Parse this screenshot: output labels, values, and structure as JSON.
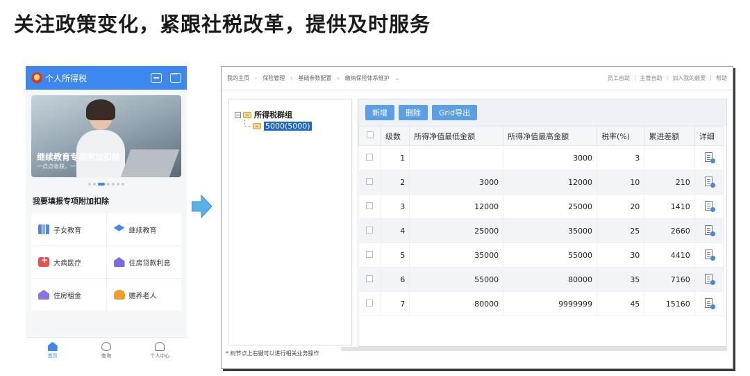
{
  "headline": "关注政策变化，紧跟社税改革，提供及时服务",
  "phone": {
    "app_title": "个人所得税",
    "banner_title": "继续教育专项附加扣除",
    "banner_subtitle": "一点点收获，一步步成长",
    "carousel_count": 7,
    "carousel_active": 3,
    "section_title": "我要填报专项附加扣除",
    "items": [
      {
        "label": "子女教育",
        "icon": "books-icon"
      },
      {
        "label": "继续教育",
        "icon": "graduation-cap-icon"
      },
      {
        "label": "大病医疗",
        "icon": "medical-kit-icon"
      },
      {
        "label": "住房贷款利息",
        "icon": "house-icon"
      },
      {
        "label": "住房租金",
        "icon": "house-icon"
      },
      {
        "label": "赡养老人",
        "icon": "elder-icon"
      }
    ],
    "tabs": [
      {
        "label": "首页",
        "icon": "home-icon",
        "active": true
      },
      {
        "label": "查询",
        "icon": "query-icon",
        "active": false
      },
      {
        "label": "个人中心",
        "icon": "user-icon",
        "active": false
      }
    ],
    "accent_color": "#3d87f0"
  },
  "window": {
    "breadcrumbs": [
      "我的主页",
      "保险管理",
      "基础参数配置",
      "缴纳保险体系维护"
    ],
    "top_links": [
      "员工自助",
      "主管自助",
      "加入我的最爱",
      "帮助"
    ],
    "tree": {
      "root_label": "所得税群组",
      "child_label": "5000(5000)"
    },
    "note": "* 树节点上右键可以进行相关业务操作",
    "toolbar": {
      "add_label": "新增",
      "delete_label": "删除",
      "export_label": "Grid导出"
    },
    "table": {
      "headers": [
        "级数",
        "所得净值最低金额",
        "所得净值最高金额",
        "税率(%)",
        "累进差额",
        "详细"
      ],
      "rows": [
        {
          "level": "1",
          "min": "",
          "max": "3000",
          "rate": "3",
          "diff": ""
        },
        {
          "level": "2",
          "min": "3000",
          "max": "12000",
          "rate": "10",
          "diff": "210"
        },
        {
          "level": "3",
          "min": "12000",
          "max": "25000",
          "rate": "20",
          "diff": "1410"
        },
        {
          "level": "4",
          "min": "25000",
          "max": "35000",
          "rate": "25",
          "diff": "2660"
        },
        {
          "level": "5",
          "min": "35000",
          "max": "55000",
          "rate": "30",
          "diff": "4410"
        },
        {
          "level": "6",
          "min": "55000",
          "max": "80000",
          "rate": "35",
          "diff": "7160"
        },
        {
          "level": "7",
          "min": "80000",
          "max": "9999999",
          "rate": "45",
          "diff": "15160"
        }
      ]
    }
  }
}
